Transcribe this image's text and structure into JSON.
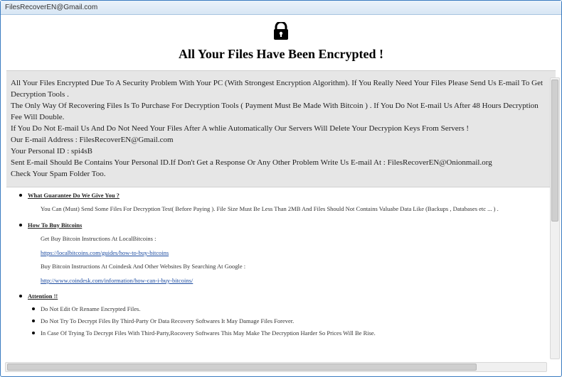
{
  "window": {
    "title": "FilesRecoverEN@Gmail.com"
  },
  "heading": "All Your Files Have Been Encrypted !",
  "message": {
    "line1": "All Your Files Encrypted Due To A Security Problem With Your PC (With Strongest Encryption Algorithm). If You Really Need Your Files Please Send Us E-mail To Get Decryption Tools .",
    "line2": "The Only Way Of Recovering Files Is To Purchase For Decryption Tools ( Payment Must Be Made With Bitcoin ) . If You Do Not E-mail Us After 48 Hours Decryption Fee Will Double.",
    "line3": "If You Do Not E-mail Us And Do Not Need Your Files After A whlie Automatically Our Servers Will Delete Your Decrypion Keys From Servers !",
    "line4": "Our E-mail Address : FilesRecoverEN@Gmail.com",
    "line5": "Your Personal ID : spi4sB",
    "line6": "Sent E-mail Should Be Contains Your Personal ID.If Don't Get a Response Or Any Other Problem Write Us E-mail At : FilesRecoverEN@Onionmail.org",
    "line7": "Check Your Spam Folder Too."
  },
  "sections": {
    "guarantee": {
      "heading": "What Guarantee Do We Give You ?",
      "text": "You Can (Must) Send Some Files For Decryption Test( Before Paying ). File Size Must Be Less Than 2MB And Files Should Not Contains Valuabe Data Like (Backups , Databases etc ... ) ."
    },
    "bitcoin": {
      "heading": "How To Buy Bitcoins",
      "p1": "Get Buy Bitcoin Instructions At LocalBitcoins :",
      "link1": "https://localbitcoins.com/guides/how-to-buy-bitcoins",
      "p2": "Buy Bitcoin Instructions At Coindesk And Other Websites By Searching At Google :",
      "link2": "http://www.coindesk.com/information/how-can-i-buy-bitcoins/"
    },
    "attention": {
      "heading": "Attention !!",
      "items": [
        "Do Not Edit Or Rename Encrypted Files.",
        "Do Not Try To Decrypt Files By Third-Party Or Data Recovery Softwares It May Damage Files Forever.",
        "In Case Of Trying To Decrypt Files With Third-Party,Rocovery Softwares This May Make The Decryption Harder So Prices Will Be Rise."
      ]
    }
  }
}
